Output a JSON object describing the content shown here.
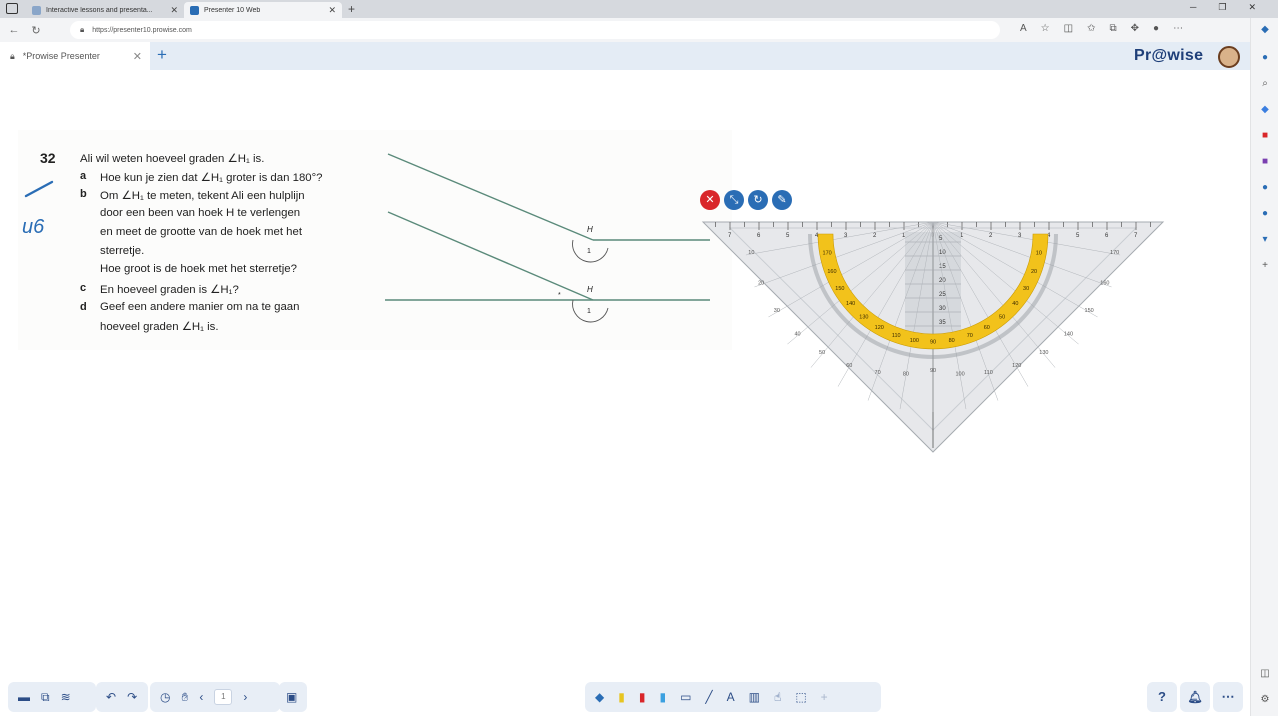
{
  "browser": {
    "tabs": [
      {
        "title": "Interactive lessons and presenta...",
        "active": false
      },
      {
        "title": "Presenter 10 Web",
        "active": true
      }
    ],
    "url": "https://presenter10.prowise.com"
  },
  "app": {
    "doc_tab": "*Prowise Presenter",
    "logo": "Pr@wise"
  },
  "exercise": {
    "number": "32",
    "lines": [
      {
        "label": "",
        "text": "Ali wil weten hoeveel graden ∠H₁ is."
      },
      {
        "label": "a",
        "text": "Hoe kun je zien dat ∠H₁ groter is dan 180°?"
      },
      {
        "label": "b",
        "text": "Om ∠H₁ te meten, tekent Ali een hulplijn"
      },
      {
        "label": "",
        "text": "door een been van hoek H te verlengen"
      },
      {
        "label": "",
        "text": "en meet de grootte van de hoek met het"
      },
      {
        "label": "",
        "text": "sterretje."
      },
      {
        "label": "",
        "text": "Hoe groot is de hoek met het sterretje?"
      },
      {
        "label": "c",
        "text": "En hoeveel graden is ∠H₁?"
      },
      {
        "label": "d",
        "text": "Geef een andere manier om na te gaan"
      },
      {
        "label": "",
        "text": "hoeveel graden ∠H₁ is."
      }
    ],
    "diagram": {
      "vertex_label": "H",
      "angle_label": "1"
    },
    "handwriting": "u6"
  },
  "protractor": {
    "controls": [
      "close-icon",
      "resize-icon",
      "rotate-icon",
      "edit-icon"
    ],
    "control_colors": {
      "close": "#d9262a",
      "other": "#2a6db5"
    },
    "arc_color": "#f2c21b",
    "outer_ticks": [
      "7",
      "6",
      "5",
      "4",
      "3",
      "2",
      "1",
      "0",
      "1",
      "2",
      "3",
      "4",
      "5",
      "6",
      "7"
    ],
    "inner_scale": [
      "5",
      "10",
      "15",
      "20",
      "25",
      "30",
      "35"
    ],
    "arc_labels": [
      "170",
      "160",
      "150",
      "140",
      "130",
      "120",
      "110",
      "100",
      "90",
      "80",
      "70",
      "60",
      "50",
      "40",
      "30",
      "20",
      "10"
    ],
    "side_degrees": [
      "10",
      "20",
      "30",
      "40",
      "50",
      "60",
      "70",
      "80",
      "90",
      "100",
      "110",
      "120",
      "130",
      "140",
      "150",
      "160",
      "170"
    ]
  },
  "toolbar": {
    "left": [
      "folder-icon",
      "shapes-icon",
      "layers-icon",
      "undo-icon",
      "redo-icon",
      "clock-icon",
      "hand-icon",
      "prev-page-icon",
      "next-page-icon",
      "screen-icon"
    ],
    "page": "1",
    "center": [
      "eraser-icon",
      "highlighter-icon",
      "pen-red-icon",
      "pen-blue-icon",
      "rectangle-icon",
      "line-icon",
      "text-icon",
      "ruler-icon",
      "hand-pointer-icon",
      "select-icon",
      "add-icon"
    ],
    "right_help": "?",
    "right": [
      "bell-icon",
      "more-icon"
    ]
  }
}
